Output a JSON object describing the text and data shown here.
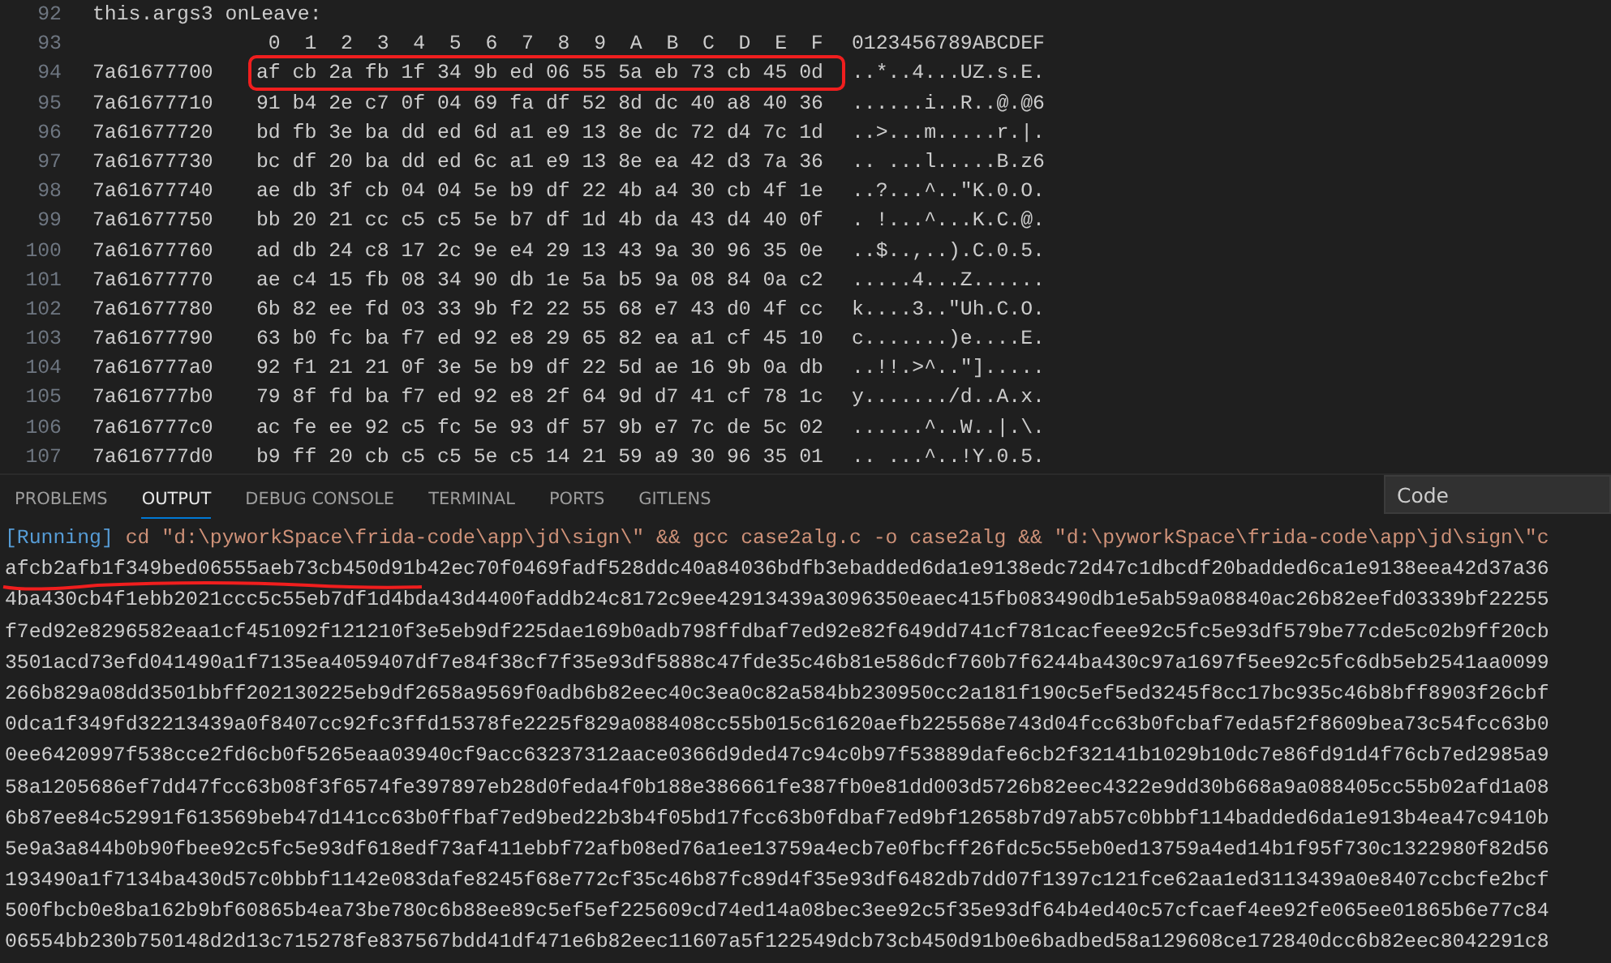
{
  "editor": {
    "code_line": {
      "number": "92",
      "text": "this.args3 onLeave:"
    },
    "header": {
      "number": "93",
      "columns": [
        "0",
        "1",
        "2",
        "3",
        "4",
        "5",
        "6",
        "7",
        "8",
        "9",
        "A",
        "B",
        "C",
        "D",
        "E",
        "F"
      ],
      "ascii": "0123456789ABCDEF"
    },
    "rows": [
      {
        "number": "94",
        "address": "7a61677700",
        "bytes": "af cb 2a fb 1f 34 9b ed 06 55 5a eb 73 cb 45 0d",
        "ascii": "..*..4...UZ.s.E.",
        "boxed": true
      },
      {
        "number": "95",
        "address": "7a61677710",
        "bytes": "91 b4 2e c7 0f 04 69 fa df 52 8d dc 40 a8 40 36",
        "ascii": "......i..R..@.@6",
        "boxed": false
      },
      {
        "number": "96",
        "address": "7a61677720",
        "bytes": "bd fb 3e ba dd ed 6d a1 e9 13 8e dc 72 d4 7c 1d",
        "ascii": "..>...m.....r.|.",
        "boxed": false
      },
      {
        "number": "97",
        "address": "7a61677730",
        "bytes": "bc df 20 ba dd ed 6c a1 e9 13 8e ea 42 d3 7a 36",
        "ascii": ".. ...l.....B.z6",
        "boxed": false
      },
      {
        "number": "98",
        "address": "7a61677740",
        "bytes": "ae db 3f cb 04 04 5e b9 df 22 4b a4 30 cb 4f 1e",
        "ascii": "..?...^..\"K.0.O.",
        "boxed": false
      },
      {
        "number": "99",
        "address": "7a61677750",
        "bytes": "bb 20 21 cc c5 c5 5e b7 df 1d 4b da 43 d4 40 0f",
        "ascii": ". !...^...K.C.@.",
        "boxed": false
      },
      {
        "number": "100",
        "address": "7a61677760",
        "bytes": "ad db 24 c8 17 2c 9e e4 29 13 43 9a 30 96 35 0e",
        "ascii": "..$..,..).C.0.5.",
        "boxed": false
      },
      {
        "number": "101",
        "address": "7a61677770",
        "bytes": "ae c4 15 fb 08 34 90 db 1e 5a b5 9a 08 84 0a c2",
        "ascii": ".....4...Z......",
        "boxed": false
      },
      {
        "number": "102",
        "address": "7a61677780",
        "bytes": "6b 82 ee fd 03 33 9b f2 22 55 68 e7 43 d0 4f cc",
        "ascii": "k....3..\"Uh.C.O.",
        "boxed": false
      },
      {
        "number": "103",
        "address": "7a61677790",
        "bytes": "63 b0 fc ba f7 ed 92 e8 29 65 82 ea a1 cf 45 10",
        "ascii": "c.......)e....E.",
        "boxed": false
      },
      {
        "number": "104",
        "address": "7a616777a0",
        "bytes": "92 f1 21 21 0f 3e 5e b9 df 22 5d ae 16 9b 0a db",
        "ascii": "..!!.>^..\"].....",
        "boxed": false
      },
      {
        "number": "105",
        "address": "7a616777b0",
        "bytes": "79 8f fd ba f7 ed 92 e8 2f 64 9d d7 41 cf 78 1c",
        "ascii": "y......./d..A.x.",
        "boxed": false
      },
      {
        "number": "106",
        "address": "7a616777c0",
        "bytes": "ac fe ee 92 c5 fc 5e 93 df 57 9b e7 7c de 5c 02",
        "ascii": "......^..W..|.\\.",
        "boxed": false
      },
      {
        "number": "107",
        "address": "7a616777d0",
        "bytes": "b9 ff 20 cb c5 c5 5e c5 14 21 59 a9 30 96 35 01",
        "ascii": ".. ...^..!Y.0.5.",
        "boxed": false
      }
    ]
  },
  "panel": {
    "tabs": [
      {
        "label": "PROBLEMS",
        "selected": false
      },
      {
        "label": "OUTPUT",
        "selected": true
      },
      {
        "label": "DEBUG CONSOLE",
        "selected": false
      },
      {
        "label": "TERMINAL",
        "selected": false
      },
      {
        "label": "PORTS",
        "selected": false
      },
      {
        "label": "GITLENS",
        "selected": false
      }
    ],
    "channel_select": "Code",
    "output": {
      "status": "[Running]",
      "command": " cd \"d:\\pyworkSpace\\frida-code\\app\\jd\\sign\\\" && gcc case2alg.c -o case2alg && \"d:\\pyworkSpace\\frida-code\\app\\jd\\sign\\\"c",
      "lines": [
        {
          "text": "afcb2afb1f349bed06555aeb73cb450d91b42ec70f0469fadf528ddc40a84036bdfb3ebadded6da1e9138edc72d47c1dbcdf20badded6ca1e9138eea42d37a36",
          "underlined": true
        },
        {
          "text": "4ba430cb4f1ebb2021ccc5c55eb7df1d4bda43d4400faddb24c8172c9ee42913439a3096350eaec415fb083490db1e5ab59a08840ac26b82eefd03339bf22255",
          "underlined": false
        },
        {
          "text": "f7ed92e8296582eaa1cf451092f121210f3e5eb9df225dae169b0adb798ffdbaf7ed92e82f649dd741cf781cacfeee92c5fc5e93df579be77cde5c02b9ff20cb",
          "underlined": false
        },
        {
          "text": "3501acd73efd041490a1f7135ea4059407df7e84f38cf7f35e93df5888c47fde35c46b81e586dcf760b7f6244ba430c97a1697f5ee92c5fc6db5eb2541aa0099",
          "underlined": false
        },
        {
          "text": "266b829a08dd3501bbff202130225eb9df2658a9569f0adb6b82eec40c3ea0c82a584bb230950cc2a181f190c5ef5ed3245f8cc17bc935c46b8bff8903f26cbf",
          "underlined": false
        },
        {
          "text": "0dca1f349fd32213439a0f8407cc92fc3ffd15378fe2225f829a088408cc55b015c61620aefb225568e743d04fcc63b0fcbaf7eda5f2f8609bea73c54fcc63b0",
          "underlined": false
        },
        {
          "text": "0ee6420997f538cce2fd6cb0f5265eaa03940cf9acc63237312aace0366d9ded47c94c0b97f53889dafe6cb2f32141b1029b10dc7e86fd91d4f76cb7ed2985a9",
          "underlined": false
        },
        {
          "text": "58a1205686ef7dd47fcc63b08f3f6574fe397897eb28d0feda4f0b188e386661fe387fb0e81dd003d5726b82eec4322e9dd30b668a9a088405cc55b02afd1a08",
          "underlined": false
        },
        {
          "text": "6b87ee84c52991f613569beb47d141cc63b0ffbaf7ed9bed22b3b4f05bd17fcc63b0fdbaf7ed9bf12658b7d97ab57c0bbbf114badded6da1e913b4ea47c9410b",
          "underlined": false
        },
        {
          "text": "5e9a3a844b0b90fbee92c5fc5e93df618edf73af411ebbf72afb08ed76a1ee13759a4ecb7e0fbcff26fdc5c55eb0ed13759a4ed14b1f95f730c1322980f82d56",
          "underlined": false
        },
        {
          "text": "193490a1f7134ba430d57c0bbbf1142e083dafe8245f68e772cf35c46b87fc89d4f35e93df6482db7dd07f1397c121fce62aa1ed3113439a0e8407ccbcfe2bcf",
          "underlined": false
        },
        {
          "text": "500fbcb0e8ba162b9bf60865b4ea73be780c6b88ee89c5ef5ef225609cd74ed14a08bec3ee92c5f35e93df64b4ed40c57cfcaef4ee92fe065ee01865b6e77c84",
          "underlined": false
        },
        {
          "text": "06554bb230b750148d2d13c715278fe837567bdd41df471e6b82eec11607a5f122549dcb73cb450d91b0e6badbed58a129608ce172840dcc6b82eec8042291c8",
          "underlined": false
        }
      ]
    }
  }
}
